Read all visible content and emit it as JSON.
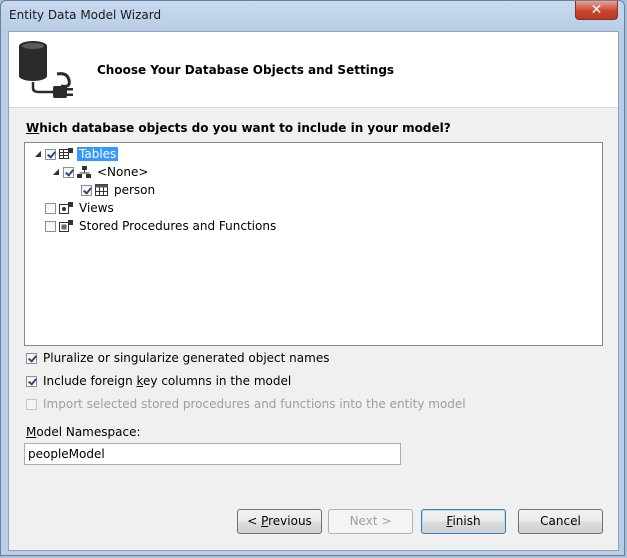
{
  "window": {
    "title": "Entity Data Model Wizard",
    "close_glyph": "✕"
  },
  "header": {
    "title": "Choose Your Database Objects and Settings",
    "icon": "database-plug-icon"
  },
  "question": {
    "prefix": "W",
    "rest": "hich database objects do you want to include in your model?"
  },
  "tree": [
    {
      "label": "Tables",
      "checked": true,
      "expanded": true,
      "selected": true,
      "icon": "tables-icon"
    },
    {
      "label": "<None>",
      "checked": true,
      "expanded": true,
      "selected": false,
      "icon": "schema-icon"
    },
    {
      "label": "person",
      "checked": true,
      "selected": false,
      "icon": "table-icon"
    },
    {
      "label": "Views",
      "checked": false,
      "selected": false,
      "icon": "views-icon"
    },
    {
      "label": "Stored Procedures and Functions",
      "checked": false,
      "selected": false,
      "icon": "procedures-icon"
    }
  ],
  "options": {
    "pluralize": {
      "label": "Pluralize or singularize generated object names",
      "checked": true,
      "enabled": true
    },
    "foreign_keys": {
      "pre": "Include foreign ",
      "accel": "k",
      "post": "ey columns in the model",
      "checked": true,
      "enabled": true
    },
    "import_procs": {
      "label": "Import selected stored procedures and functions into the entity model",
      "checked": false,
      "enabled": false
    }
  },
  "namespace": {
    "label_accel": "M",
    "label_rest": "odel Namespace:",
    "value": "peopleModel"
  },
  "buttons": {
    "previous": {
      "pre": "< ",
      "accel": "P",
      "post": "revious"
    },
    "next": {
      "label": "Next >"
    },
    "finish": {
      "accel": "F",
      "post": "inish"
    },
    "cancel": {
      "label": "Cancel"
    }
  },
  "colors": {
    "selection": "#3399ff",
    "frame": "#b9cde6",
    "close": "#c8442d"
  }
}
